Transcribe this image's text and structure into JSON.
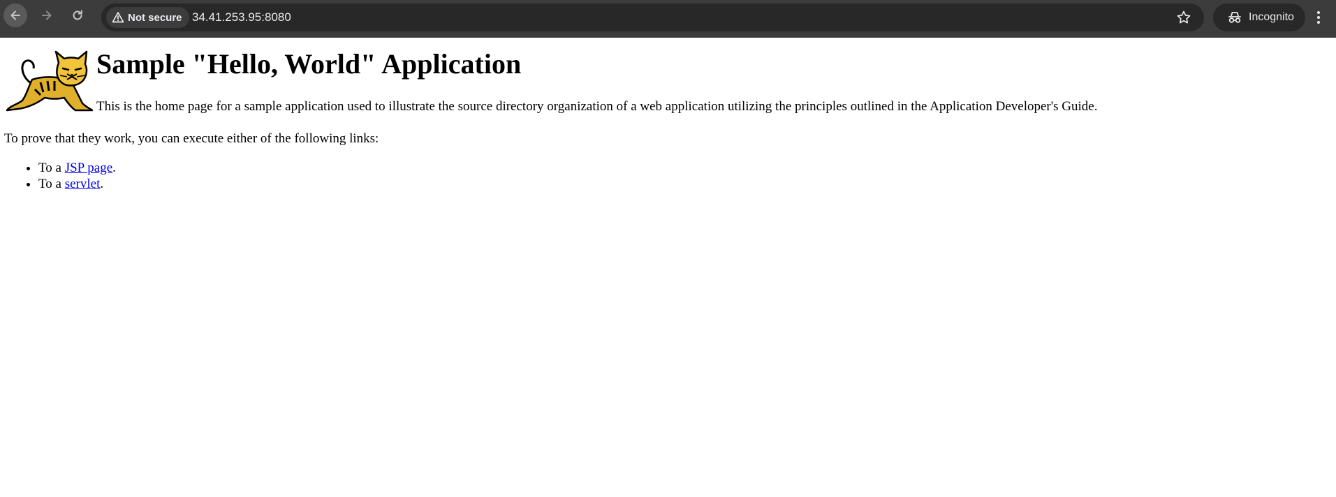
{
  "browser": {
    "security_label": "Not secure",
    "url": "34.41.253.95:8080",
    "profile_label": "Incognito",
    "icons": {
      "back": "arrow-left-icon",
      "forward": "arrow-right-icon",
      "reload": "reload-icon",
      "security": "warning-triangle-icon",
      "bookmark": "star-icon",
      "incognito": "incognito-icon",
      "menu": "kebab-menu-icon"
    }
  },
  "page": {
    "logo": "tomcat-logo",
    "title": "Sample \"Hello, World\" Application",
    "intro": "This is the home page for a sample application used to illustrate the source directory organization of a web application utilizing the principles outlined in the Application Developer's Guide.",
    "prove_text": "To prove that they work, you can execute either of the following links:",
    "links": [
      {
        "prefix": "To a ",
        "label": "JSP page",
        "suffix": "."
      },
      {
        "prefix": "To a ",
        "label": "servlet",
        "suffix": "."
      }
    ],
    "link_color": "#0000ee"
  }
}
